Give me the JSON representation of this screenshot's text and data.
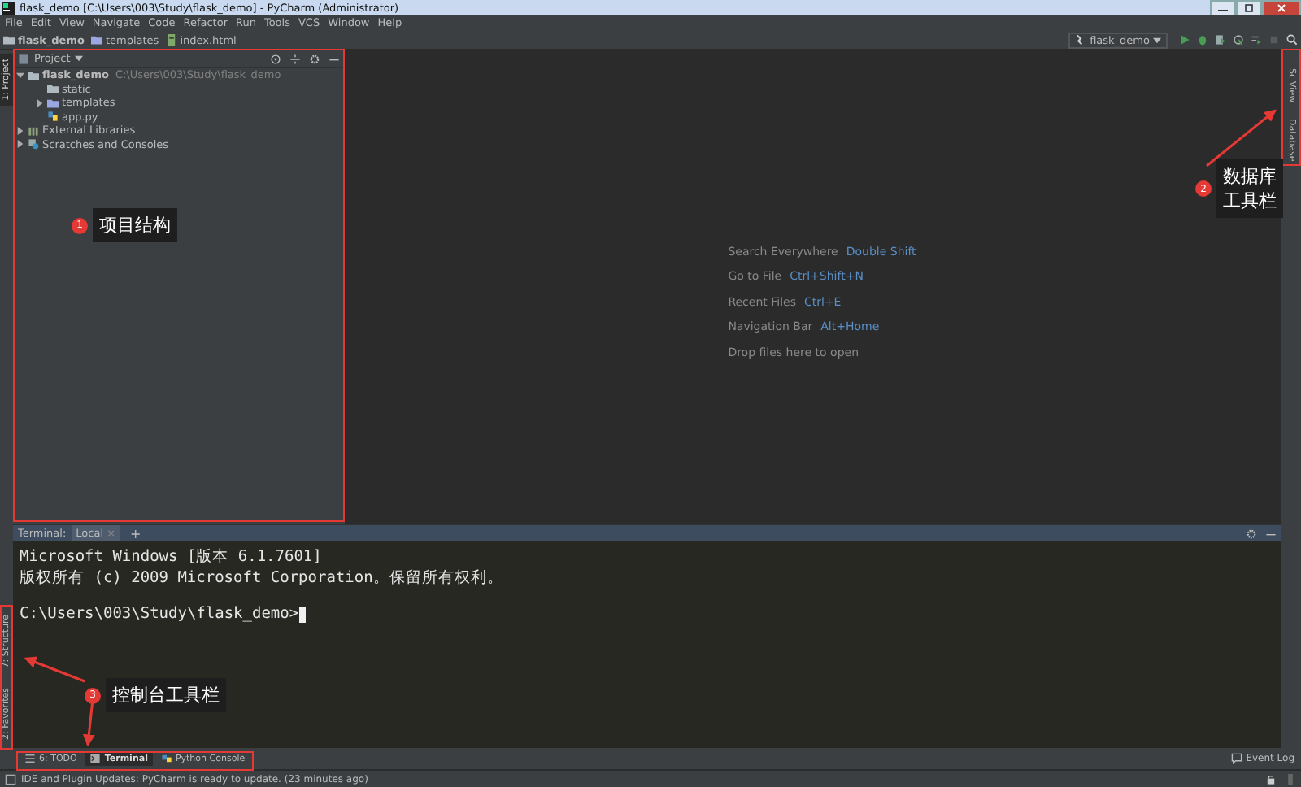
{
  "window": {
    "title": "flask_demo [C:\\Users\\003\\Study\\flask_demo] - PyCharm (Administrator)"
  },
  "menu": [
    "File",
    "Edit",
    "View",
    "Navigate",
    "Code",
    "Refactor",
    "Run",
    "Tools",
    "VCS",
    "Window",
    "Help"
  ],
  "breadcrumbs": [
    {
      "label": "flask_demo",
      "kind": "project"
    },
    {
      "label": "templates",
      "kind": "folder"
    },
    {
      "label": "index.html",
      "kind": "html"
    }
  ],
  "toolbar": {
    "run_config": "flask_demo"
  },
  "left_stripe_top": [
    {
      "label": "1: Project",
      "selected": true
    }
  ],
  "left_stripe_bottom": [
    {
      "label": "7: Structure",
      "selected": false
    },
    {
      "label": "2: Favorites",
      "selected": false
    }
  ],
  "project_panel": {
    "title": "Project",
    "tree": [
      {
        "name": "flask_demo",
        "path": "C:\\Users\\003\\Study\\flask_demo",
        "kind": "folder",
        "expanded": true,
        "children": [
          {
            "name": "static",
            "kind": "folder"
          },
          {
            "name": "templates",
            "kind": "template-folder",
            "expanded": false
          },
          {
            "name": "app.py",
            "kind": "python"
          }
        ]
      },
      {
        "name": "External Libraries",
        "kind": "library",
        "expanded": false
      },
      {
        "name": "Scratches and Consoles",
        "kind": "scratch",
        "expanded": false
      }
    ]
  },
  "editor_hints": [
    {
      "action": "Search Everywhere",
      "shortcut": "Double Shift"
    },
    {
      "action": "Go to File",
      "shortcut": "Ctrl+Shift+N"
    },
    {
      "action": "Recent Files",
      "shortcut": "Ctrl+E"
    },
    {
      "action": "Navigation Bar",
      "shortcut": "Alt+Home"
    },
    {
      "action": "Drop files here to open"
    }
  ],
  "right_stripe": [
    {
      "label": "SciView",
      "selected": false
    },
    {
      "label": "Database",
      "selected": false
    }
  ],
  "terminal": {
    "label": "Terminal:",
    "tabs": [
      {
        "label": "Local",
        "close": "×",
        "selected": true
      }
    ],
    "add": "+",
    "lines": [
      "Microsoft Windows [版本 6.1.7601]",
      "版权所有 (c) 2009 Microsoft Corporation。保留所有权利。"
    ],
    "prompt": "C:\\Users\\003\\Study\\flask_demo>"
  },
  "tool_buttons": [
    {
      "label": "6: TODO",
      "kind": "todo",
      "selected": false
    },
    {
      "label": "Terminal",
      "kind": "terminal",
      "selected": true
    },
    {
      "label": "Python Console",
      "kind": "console",
      "selected": false
    }
  ],
  "event_log": "Event Log",
  "status_bar": "IDE and Plugin Updates: PyCharm is ready to update. (23 minutes ago)",
  "annotations": [
    {
      "number": "1",
      "lines": [
        "项目结构"
      ]
    },
    {
      "number": "2",
      "lines": [
        "数据库",
        "工具栏"
      ]
    },
    {
      "number": "3",
      "lines": [
        "控制台工具栏"
      ]
    }
  ]
}
